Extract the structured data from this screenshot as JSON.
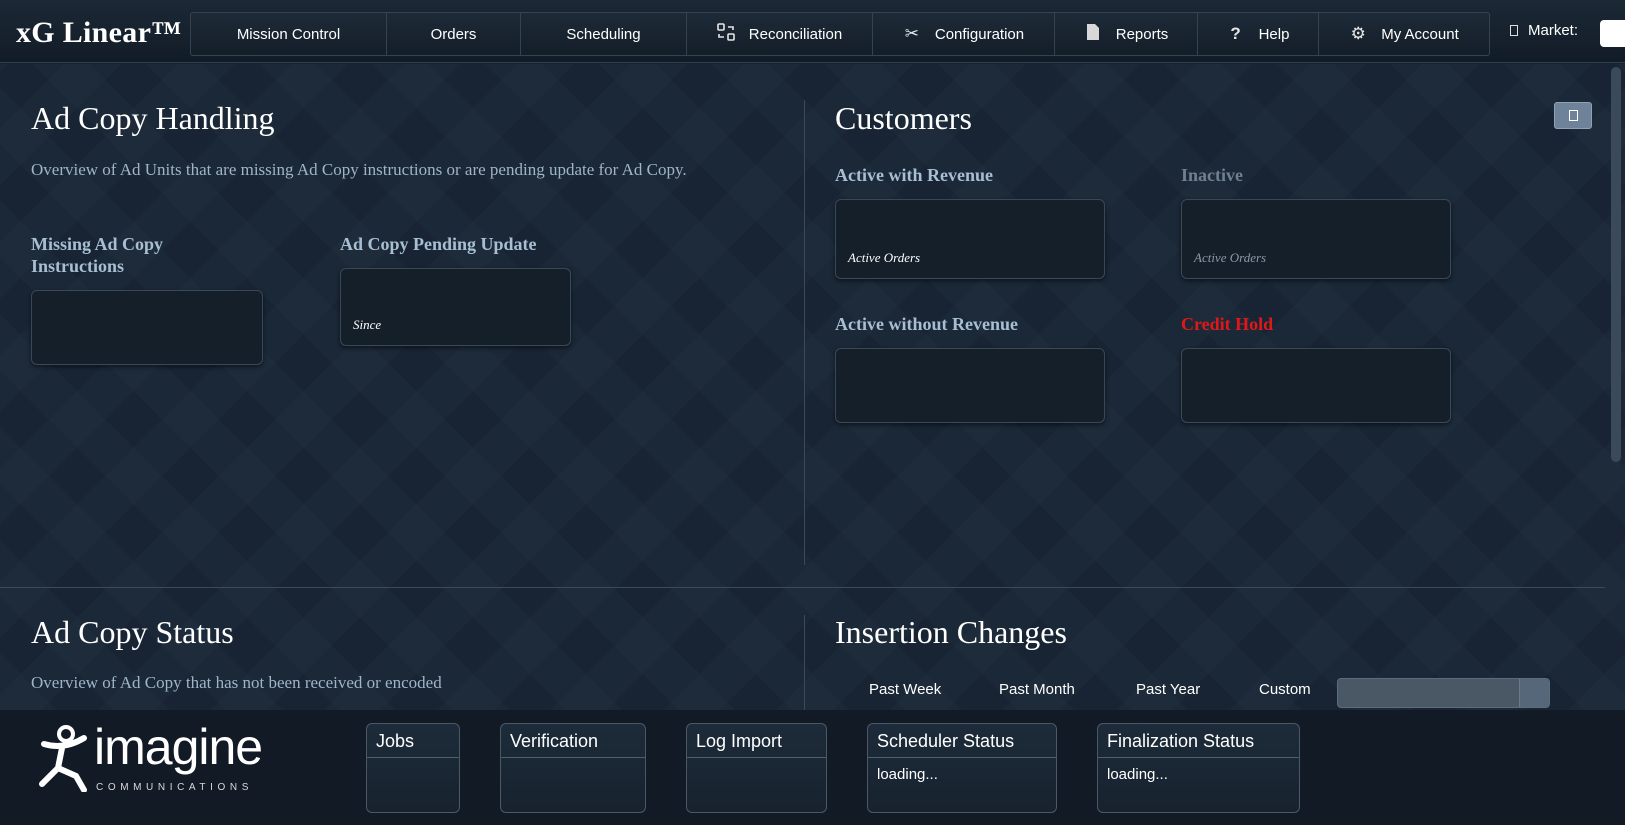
{
  "header": {
    "brand": "xG Linear™",
    "nav": [
      {
        "label": "Mission Control",
        "icon": ""
      },
      {
        "label": "Orders",
        "icon": ""
      },
      {
        "label": "Scheduling",
        "icon": ""
      },
      {
        "label": "Reconciliation",
        "icon": "reconciliation-icon"
      },
      {
        "label": "Configuration",
        "icon": "tools-icon"
      },
      {
        "label": "Reports",
        "icon": "document-icon"
      },
      {
        "label": "Help",
        "icon": "question-icon"
      },
      {
        "label": "My Account",
        "icon": "gear-icon"
      }
    ],
    "market_label": "Market:"
  },
  "ad_copy_handling": {
    "title": "Ad Copy Handling",
    "description": "Overview of Ad Units that are missing Ad Copy instructions or are pending update for Ad Copy.",
    "missing_label": "Missing Ad Copy Instructions",
    "pending_label": "Ad Copy Pending Update",
    "pending_sub": "Since"
  },
  "customers": {
    "title": "Customers",
    "active_with_revenue": "Active with Revenue",
    "active_with_revenue_sub": "Active Orders",
    "inactive": "Inactive",
    "inactive_sub": "Active Orders",
    "active_without_revenue": "Active without Revenue",
    "credit_hold": "Credit Hold"
  },
  "ad_copy_status": {
    "title": "Ad Copy Status",
    "description": "Overview of Ad Copy that has not been received or encoded"
  },
  "insertion_changes": {
    "title": "Insertion Changes",
    "ranges": [
      "Past Week",
      "Past Month",
      "Past Year",
      "Custom"
    ]
  },
  "footer": {
    "logo_word": "imagine",
    "logo_sub": "COMMUNICATIONS",
    "widgets": [
      {
        "title": "Jobs",
        "body": ""
      },
      {
        "title": "Verification",
        "body": ""
      },
      {
        "title": "Log Import",
        "body": ""
      },
      {
        "title": "Scheduler Status",
        "body": "loading..."
      },
      {
        "title": "Finalization Status",
        "body": "loading..."
      }
    ]
  },
  "colors": {
    "background": "#182636",
    "credit_hold": "#e01818",
    "label": "#a8bfd3"
  }
}
